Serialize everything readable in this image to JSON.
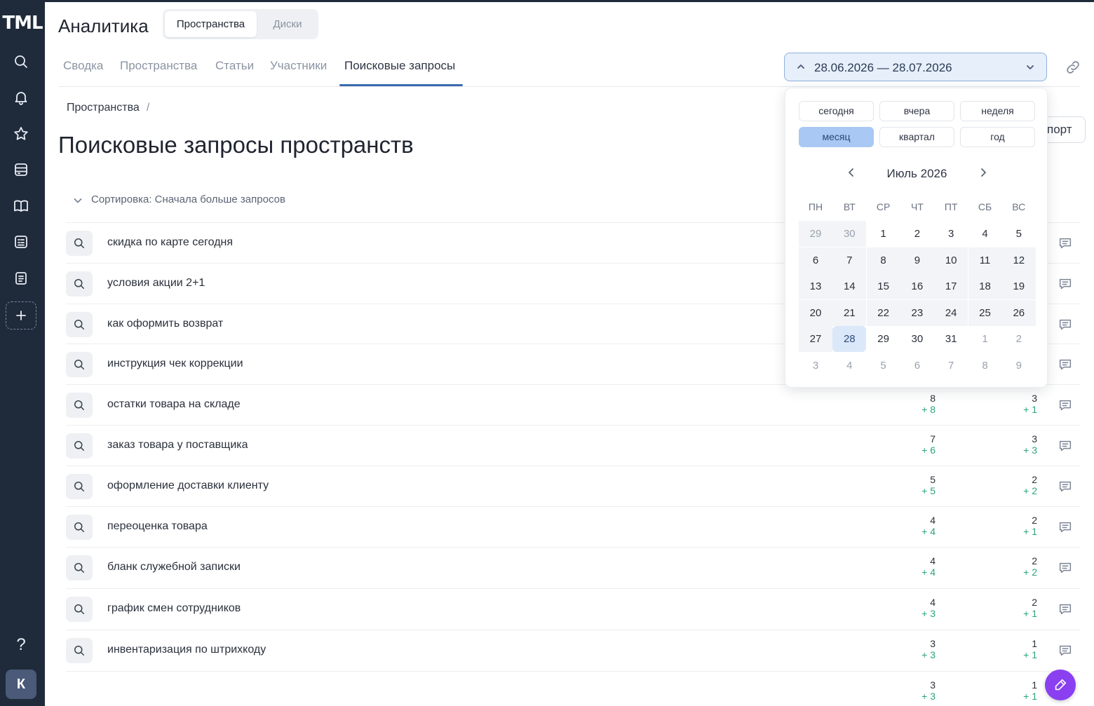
{
  "logo": "TML",
  "app_title": "Аналитика",
  "segment": {
    "active": "Пространства",
    "inactive": "Диски"
  },
  "tabs": [
    "Сводка",
    "Пространства",
    "Статьи",
    "Участники",
    "Поисковые запросы"
  ],
  "active_tab": "Поисковые запросы",
  "date_range": "28.06.2026 — 28.07.2026",
  "breadcrumb": {
    "item": "Пространства",
    "sep": "/"
  },
  "page_title": "Поисковые запросы пространств",
  "export_label": "порт",
  "sort_label": "Сортировка: Сначала больше запросов",
  "avatar_letter": "К",
  "help_label": "?",
  "rows": [
    {
      "query": "скидка по карте сегодня",
      "v1": "",
      "d1": "",
      "v2": "",
      "d2": ""
    },
    {
      "query": "условия акции 2+1",
      "v1": "",
      "d1": "",
      "v2": "",
      "d2": ""
    },
    {
      "query": "как оформить возврат",
      "v1": "",
      "d1": "",
      "v2": "",
      "d2": ""
    },
    {
      "query": "инструкция чек коррекции",
      "v1": "",
      "d1": "",
      "v2": "",
      "d2": ""
    },
    {
      "query": "остатки товара на складе",
      "v1": "8",
      "d1": "+ 8",
      "v2": "3",
      "d2": "+ 1"
    },
    {
      "query": "заказ товара у поставщика",
      "v1": "7",
      "d1": "+ 6",
      "v2": "3",
      "d2": "+ 3"
    },
    {
      "query": "оформление доставки клиенту",
      "v1": "5",
      "d1": "+ 5",
      "v2": "2",
      "d2": "+ 2"
    },
    {
      "query": "переоценка товара",
      "v1": "4",
      "d1": "+ 4",
      "v2": "2",
      "d2": "+ 1"
    },
    {
      "query": "бланк служебной записки",
      "v1": "4",
      "d1": "+ 4",
      "v2": "2",
      "d2": "+ 2"
    },
    {
      "query": "график смен сотрудников",
      "v1": "4",
      "d1": "+ 3",
      "v2": "2",
      "d2": "+ 1"
    },
    {
      "query": "инвентаризация по штрихкоду",
      "v1": "3",
      "d1": "+ 3",
      "v2": "1",
      "d2": "+ 1"
    },
    {
      "query": "",
      "v1": "3",
      "d1": "+ 3",
      "v2": "1",
      "d2": "+ 1"
    }
  ],
  "calendar": {
    "presets": [
      "сегодня",
      "вчера",
      "неделя",
      "месяц",
      "квартал",
      "год"
    ],
    "active_preset": "месяц",
    "month_title": "Июль 2026",
    "weekdays": [
      "ПН",
      "ВТ",
      "СР",
      "ЧТ",
      "ПТ",
      "СБ",
      "ВС"
    ],
    "weeks": [
      [
        "29",
        "30",
        "1",
        "2",
        "3",
        "4",
        "5"
      ],
      [
        "6",
        "7",
        "8",
        "9",
        "10",
        "11",
        "12"
      ],
      [
        "13",
        "14",
        "15",
        "16",
        "17",
        "18",
        "19"
      ],
      [
        "20",
        "21",
        "22",
        "23",
        "24",
        "25",
        "26"
      ],
      [
        "27",
        "28",
        "29",
        "30",
        "31",
        "1",
        "2"
      ],
      [
        "3",
        "4",
        "5",
        "6",
        "7",
        "8",
        "9"
      ]
    ],
    "selected_day": "28"
  }
}
